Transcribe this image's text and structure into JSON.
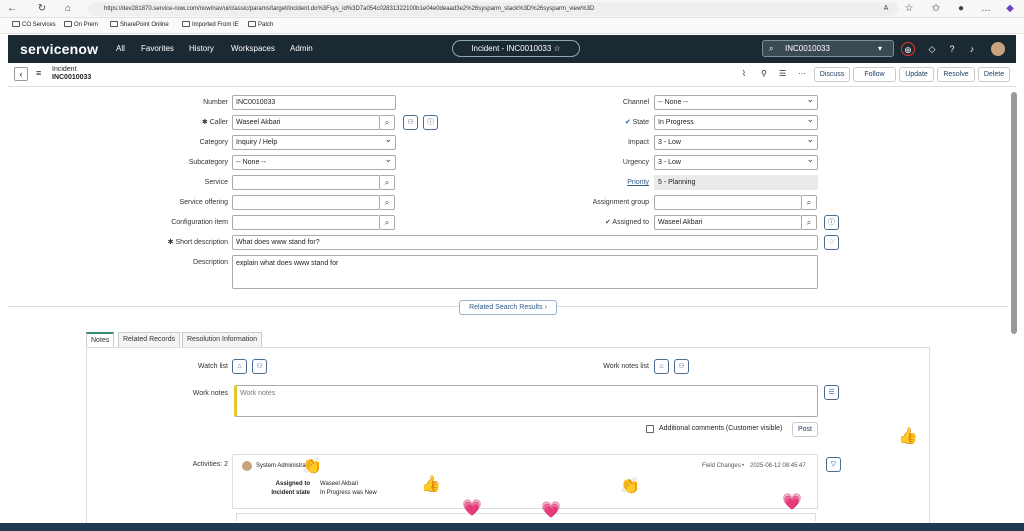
{
  "browser": {
    "url": "https://dev281870.service-now.com/now/nav/ui/classic/params/target/incident.do%3Fsys_id%3D7a054c02831322100b1e04e0deaad3e2%26sysparm_stack%3D%26sysparm_view%3D",
    "bookmarks": [
      "CO Services",
      "On Prem",
      "SharePoint Online",
      "Imported From IE",
      "Patch"
    ]
  },
  "header": {
    "logo": "servicenow",
    "menu": [
      "All",
      "Favorites",
      "History",
      "Workspaces",
      "Admin"
    ],
    "pill": "Incident - INC0010033 ☆",
    "search_value": "INC0010033"
  },
  "formbar": {
    "type": "Incident",
    "number": "INC0010033",
    "buttons": [
      "Discuss",
      "Follow",
      "Update",
      "Resolve",
      "Delete"
    ]
  },
  "form": {
    "number": {
      "label": "Number",
      "value": "INC0010033"
    },
    "caller": {
      "label": "Caller",
      "value": "Waseel Akbari"
    },
    "category": {
      "label": "Category",
      "value": "Inquiry / Help"
    },
    "subcategory": {
      "label": "Subcategory",
      "value": "-- None --"
    },
    "service": {
      "label": "Service",
      "value": ""
    },
    "service_offering": {
      "label": "Service offering",
      "value": ""
    },
    "configuration_item": {
      "label": "Configuration item",
      "value": ""
    },
    "short_description": {
      "label": "Short description",
      "value": "What does www stand for?"
    },
    "description": {
      "label": "Description",
      "value": "explain what does www stand for"
    },
    "channel": {
      "label": "Channel",
      "value": "-- None --"
    },
    "state": {
      "label": "State",
      "value": "In Progress"
    },
    "impact": {
      "label": "Impact",
      "value": "3 - Low"
    },
    "urgency": {
      "label": "Urgency",
      "value": "3 - Low"
    },
    "priority": {
      "label": "Priority",
      "value": "5 - Planning"
    },
    "assignment_group": {
      "label": "Assignment group",
      "value": ""
    },
    "assigned_to": {
      "label": "Assigned to",
      "value": "Waseel Akbari"
    },
    "related_search": "Related Search Results"
  },
  "tabs": [
    "Notes",
    "Related Records",
    "Resolution Information"
  ],
  "notes": {
    "watch_list": "Watch list",
    "work_notes_list": "Work notes list",
    "work_notes_label": "Work notes",
    "work_notes_placeholder": "Work notes",
    "additional_comments": "Additional comments (Customer visible)",
    "post": "Post",
    "activities": "Activities: 2",
    "activity": {
      "user": "System Administrator",
      "type": "Field Changes",
      "timestamp": "2025-08-12 08:45:47",
      "rows": [
        {
          "field": "Assigned to",
          "value": "Waseel Akbari"
        },
        {
          "field": "Incident state",
          "value": "In Progress  was  New"
        }
      ]
    }
  },
  "emojis": {
    "thumb": "👍",
    "clap": "👏",
    "heart": "💗",
    "wave": "👋"
  }
}
